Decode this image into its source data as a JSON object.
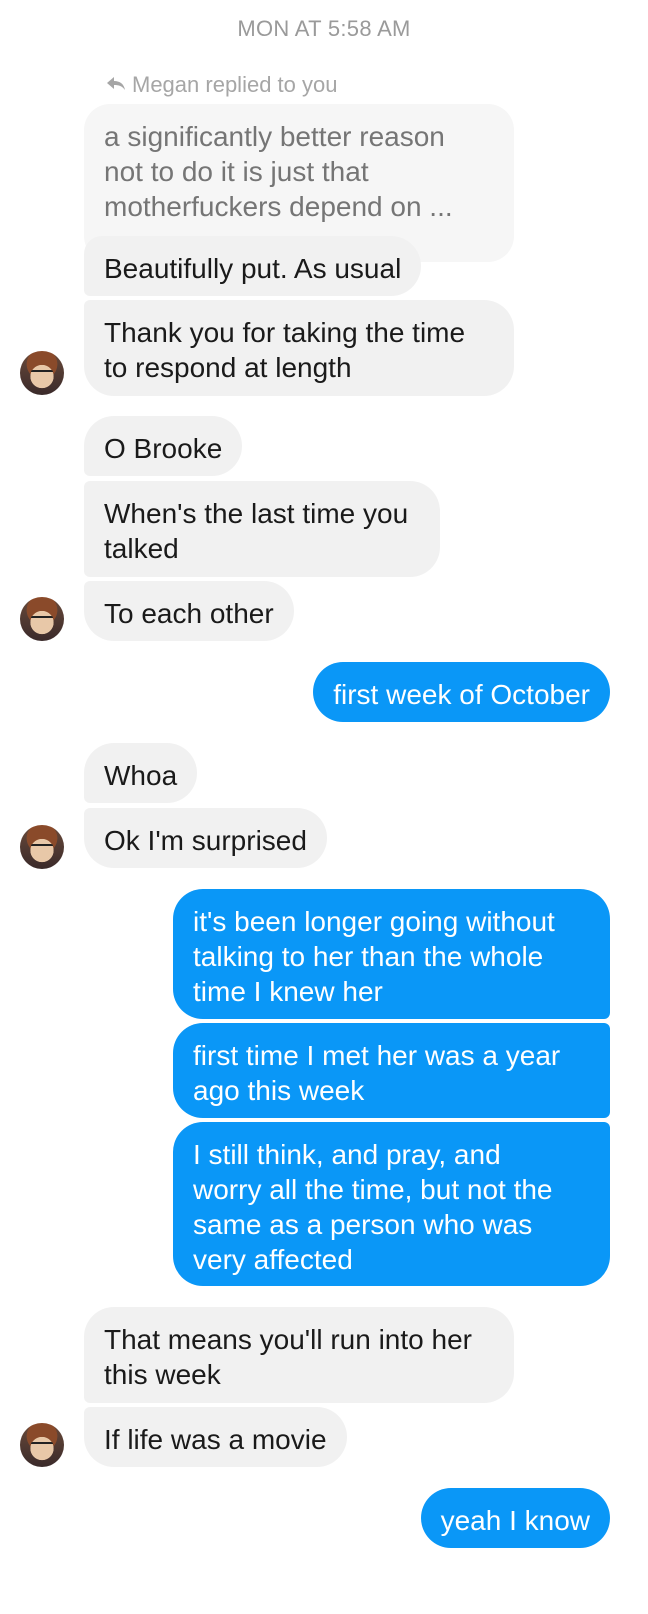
{
  "timestamp": "MON AT 5:58 AM",
  "reply_note": {
    "icon": "reply-icon",
    "text": "Megan replied to you"
  },
  "quoted_message": "a significantly better reason\nnot to do it is just that\nmotherfuckers depend on ...",
  "messages": [
    {
      "dir": "in",
      "text": "Beautifully put. As usual"
    },
    {
      "dir": "in",
      "text": "Thank you for taking the time\nto respond at length"
    },
    {
      "dir": "in",
      "text": "O Brooke"
    },
    {
      "dir": "in",
      "text": "When's the last time you\ntalked"
    },
    {
      "dir": "in",
      "text": "To each other"
    },
    {
      "dir": "out",
      "text": "first week of October"
    },
    {
      "dir": "in",
      "text": "Whoa"
    },
    {
      "dir": "in",
      "text": "Ok I'm surprised"
    },
    {
      "dir": "out",
      "text": "it's been longer going without\ntalking to her than the whole\ntime I knew her"
    },
    {
      "dir": "out",
      "text": "first time I met her was a year\nago this week"
    },
    {
      "dir": "out",
      "text": "I still think, and pray, and\nworry all the time, but not the\nsame as a person who was\nvery affected"
    },
    {
      "dir": "in",
      "text": "That means you'll run into her\nthis week"
    },
    {
      "dir": "in",
      "text": "If life was a movie"
    },
    {
      "dir": "out",
      "text": "yeah I know"
    }
  ],
  "colors": {
    "incoming_bubble": "#f1f1f1",
    "outgoing_bubble": "#0a97f7",
    "timestamp": "#9a9a9a"
  }
}
